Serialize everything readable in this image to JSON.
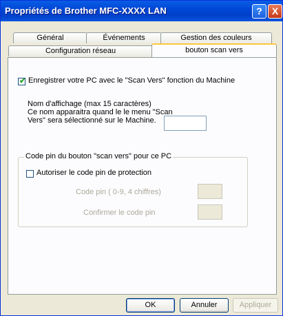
{
  "window": {
    "title": "Propriétés de Brother MFC-XXXX  LAN",
    "help_glyph": "?",
    "close_glyph": "X"
  },
  "tabs": {
    "row1": [
      "Général",
      "Événements",
      "Gestion des couleurs"
    ],
    "row2": [
      "Configuration réseau",
      "bouton scan vers"
    ],
    "active": "bouton scan vers"
  },
  "register": {
    "checked": true,
    "label": "Enregistrer votre PC avec le \"Scan Vers\" fonction du Machine"
  },
  "display_name": {
    "line1": "Nom d'affichage (max 15 caractères)",
    "line2": "Ce nom apparaitra quand le le menu \"Scan",
    "line3": "Vers\" sera sélectionné sur le Machine.",
    "value": ""
  },
  "pin_group": {
    "legend": "Code pin du bouton \"scan vers\" pour ce PC",
    "enable_label": "Autoriser le code pin de protection",
    "enable_checked": false,
    "pin_label": "Code pin ( 0-9, 4 chiffres)",
    "confirm_label": "Confirmer le code pin",
    "pin_value": "",
    "confirm_value": ""
  },
  "buttons": {
    "ok": "OK",
    "cancel": "Annuler",
    "apply": "Appliquer"
  }
}
